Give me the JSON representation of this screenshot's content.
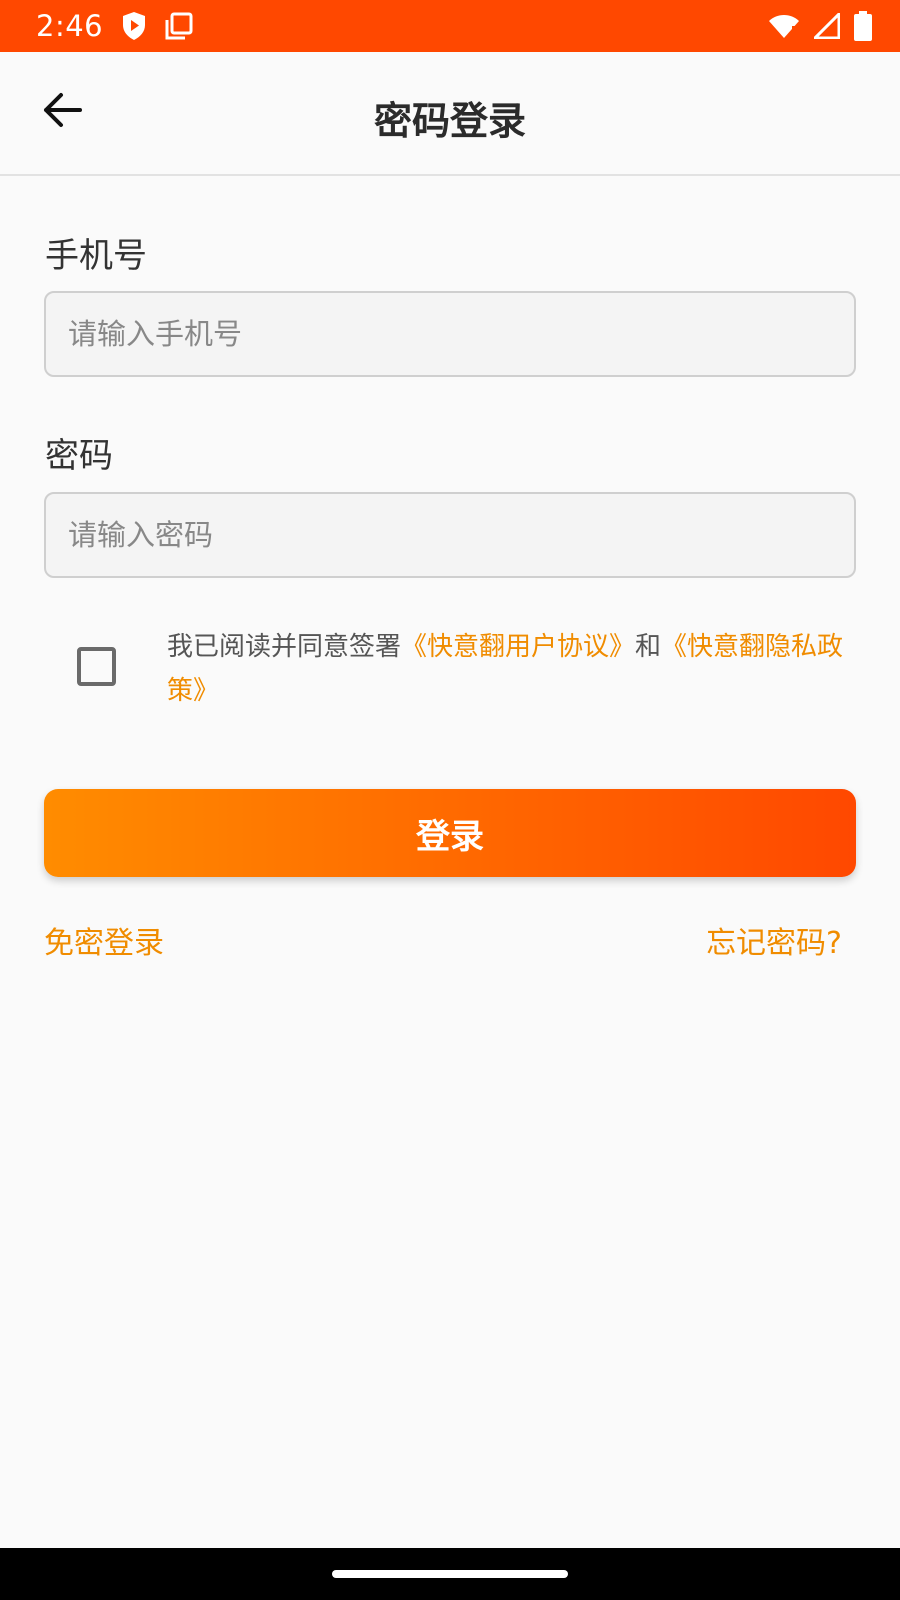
{
  "status_bar": {
    "time": "2:46",
    "left_icons": [
      "shield-play-icon",
      "screenshot-icon"
    ],
    "right_icons": [
      "wifi-icon",
      "signal-icon",
      "battery-icon"
    ],
    "background": "#ff4800"
  },
  "app_bar": {
    "title": "密码登录",
    "back_icon": "arrow-left-icon"
  },
  "form": {
    "phone_label": "手机号",
    "phone_placeholder": "请输入手机号",
    "phone_value": "",
    "password_label": "密码",
    "password_placeholder": "请输入密码",
    "password_value": ""
  },
  "agreement": {
    "checked": false,
    "prefix": "我已阅读并同意签署",
    "user_agreement": "《快意翻用户协议》",
    "connector": "和",
    "privacy_policy": "《快意翻隐私政策》"
  },
  "actions": {
    "login_label": "登录",
    "passwordless_login": "免密登录",
    "forgot_password": "忘记密码?"
  },
  "colors": {
    "accent": "#f08c00",
    "gradient_start": "#ff8c00",
    "gradient_end": "#ff4800"
  }
}
